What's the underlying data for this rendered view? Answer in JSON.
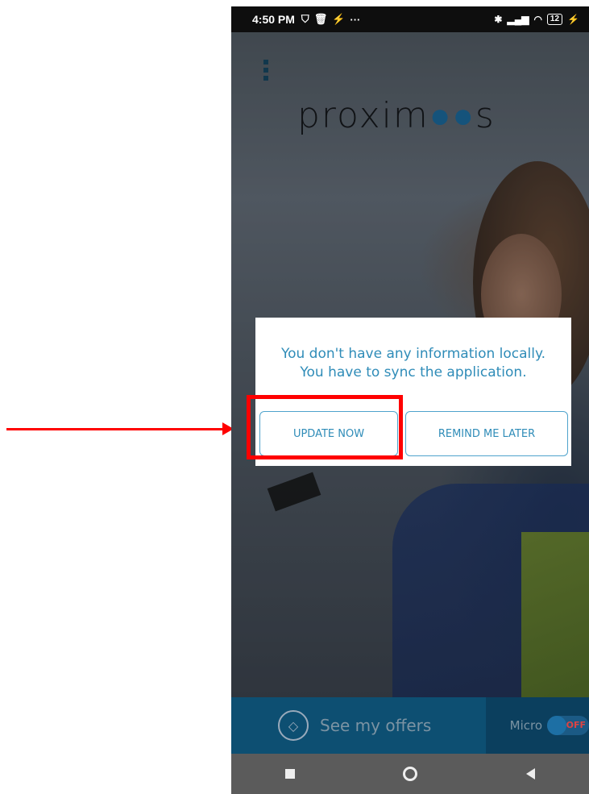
{
  "status_bar": {
    "time": "4:50 PM",
    "left_icons": [
      "shield-icon",
      "trash-icon",
      "lightning-icon"
    ],
    "more": "···",
    "right_icons": [
      "bluetooth-icon",
      "signal-icon",
      "wifi-icon"
    ],
    "battery": "12"
  },
  "app": {
    "logo_text_start": "proxim",
    "logo_text_end": "s"
  },
  "dialog": {
    "message": "You don't have any information locally. You have to sync the application.",
    "update_label": "UPDATE NOW",
    "remind_label": "REMIND ME LATER"
  },
  "bottom_bar": {
    "offers_label": "See my offers",
    "micro_label": "Micro",
    "toggle_state": "OFF"
  },
  "colors": {
    "accent": "#2f8cb8",
    "annotation": "#ff0000",
    "bar": "#0d4f72"
  }
}
